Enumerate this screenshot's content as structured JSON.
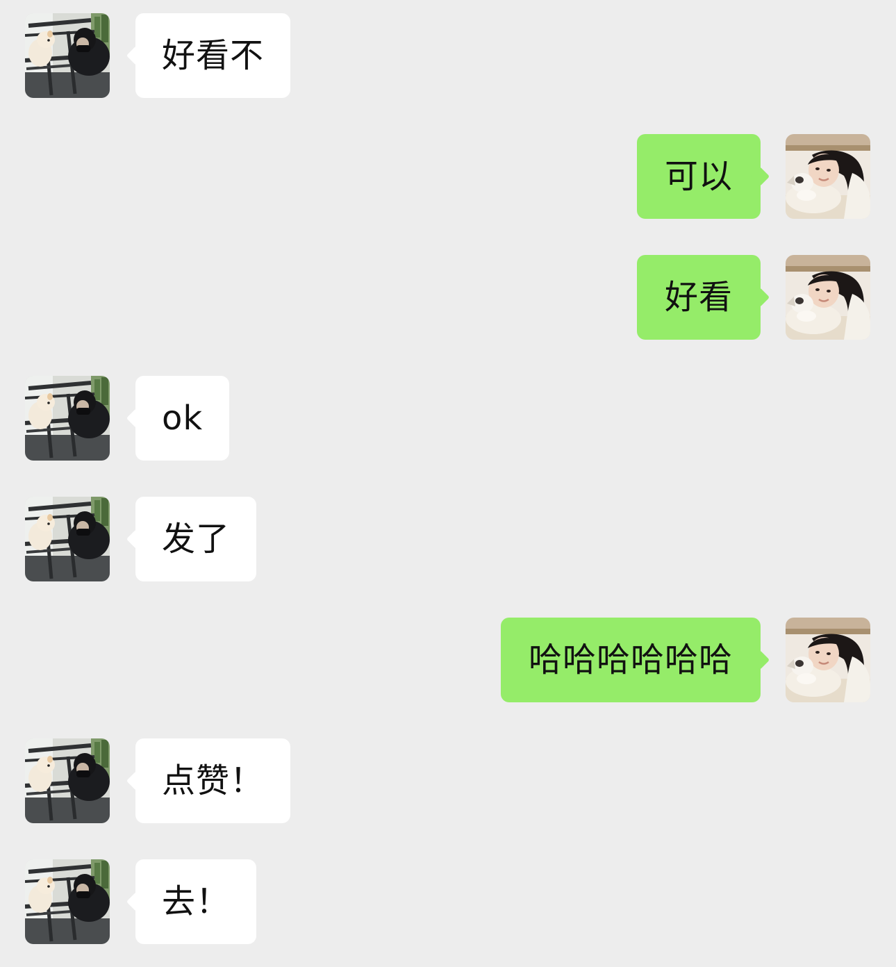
{
  "colors": {
    "background": "#ededed",
    "incoming_bubble": "#ffffff",
    "outgoing_bubble": "#95ec69",
    "text": "#111111"
  },
  "messages": [
    {
      "sender": "contact",
      "avatar": "contact-avatar-dog-photo",
      "text": "好看不"
    },
    {
      "sender": "me",
      "avatar": "me-avatar-girl-photo",
      "text": "可以"
    },
    {
      "sender": "me",
      "avatar": "me-avatar-girl-photo",
      "text": "好看"
    },
    {
      "sender": "contact",
      "avatar": "contact-avatar-dog-photo",
      "text": "ok"
    },
    {
      "sender": "contact",
      "avatar": "contact-avatar-dog-photo",
      "text": "发了"
    },
    {
      "sender": "me",
      "avatar": "me-avatar-girl-photo",
      "text": "哈哈哈哈哈哈"
    },
    {
      "sender": "contact",
      "avatar": "contact-avatar-dog-photo",
      "text": "点赞！"
    },
    {
      "sender": "contact",
      "avatar": "contact-avatar-dog-photo",
      "text": "去！"
    }
  ]
}
